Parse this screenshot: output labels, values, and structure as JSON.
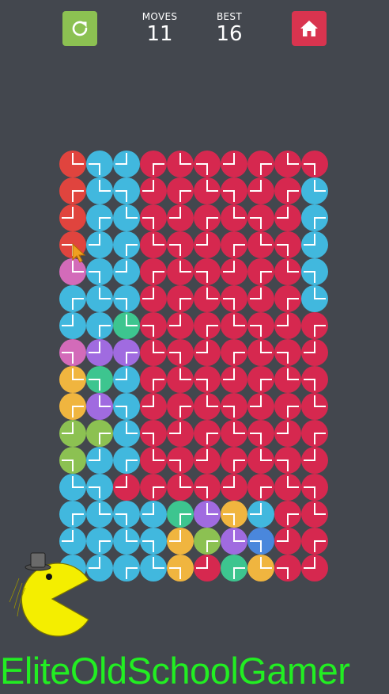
{
  "toolbar": {
    "moves_label": "MOVES",
    "moves_value": "11",
    "best_label": "BEST",
    "best_value": "16",
    "restart_icon": "restart-icon",
    "home_icon": "home-icon"
  },
  "palette": {
    "R": "#d6284f",
    "B": "#41b8de",
    "O": "#e0443e",
    "P": "#d36bb9",
    "V": "#a06be0",
    "G": "#3dc58f",
    "Y": "#f0b53f",
    "L": "#8cc152",
    "D": "#4a87dc"
  },
  "board": {
    "columns": 10,
    "rows": 16,
    "grid": [
      "OBBRRRRRRR",
      "OBBRRRRRRB",
      "OBBRRRRRRB",
      "OBBRRRRRRB",
      "PBBRRRRRRB",
      "BBBRRRRRRB",
      "BBGRRRRRRR",
      "PVVRRRRRRR",
      "YGBRRRRRRR",
      "YVBRRRRRRR",
      "LLBRRRRRRR",
      "LBBRRRRRRR",
      "BBRRRRRRRR",
      "BBBBGVYBRR",
      "BBBBYLVDRR",
      "BBBBYRGYRR"
    ]
  },
  "watermark": {
    "text": "EliteOldSchoolGamer"
  }
}
